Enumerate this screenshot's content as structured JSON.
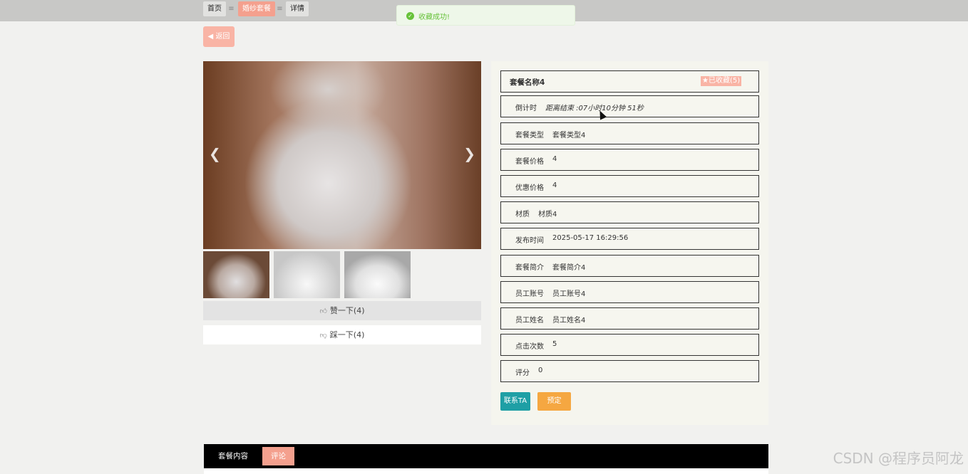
{
  "breadcrumb": {
    "home": "首页",
    "separator": "≡",
    "category": "婚纱套餐",
    "detail": "详情"
  },
  "toast": {
    "message": "收藏成功!"
  },
  "back_label": "返回",
  "gallery": {
    "prev_icon": "chevron-left-icon",
    "next_icon": "chevron-right-icon",
    "thumbnail_count": 3
  },
  "votes": {
    "like_label": "赞一下(4)",
    "dislike_label": "踩一下(4)"
  },
  "package": {
    "name": "套餐名称4",
    "favorite_label": "已收藏(5)",
    "fields": [
      {
        "label": "倒计时",
        "value": "距离结束 :07小时10分钟 51秒"
      },
      {
        "label": "套餐类型",
        "value": "套餐类型4"
      },
      {
        "label": "套餐价格",
        "value": "4"
      },
      {
        "label": "优惠价格",
        "value": "4"
      },
      {
        "label": "材质",
        "value": "材质4"
      },
      {
        "label": "发布时间",
        "value": "2025-05-17 16:29:56"
      },
      {
        "label": "套餐简介",
        "value": "套餐简介4"
      },
      {
        "label": "员工账号",
        "value": "员工账号4"
      },
      {
        "label": "员工姓名",
        "value": "员工姓名4"
      },
      {
        "label": "点击次数",
        "value": "5"
      },
      {
        "label": "评分",
        "value": "0"
      }
    ]
  },
  "actions": {
    "contact": "联系TA",
    "book": "预定"
  },
  "tabs": {
    "content": "套餐内容",
    "comment": "评论"
  },
  "watermark": "CSDN @程序员阿龙",
  "colors": {
    "accent": "#f4a08e",
    "contact": "#1e9fa5",
    "book": "#f5a741",
    "success": "#67c23a"
  }
}
